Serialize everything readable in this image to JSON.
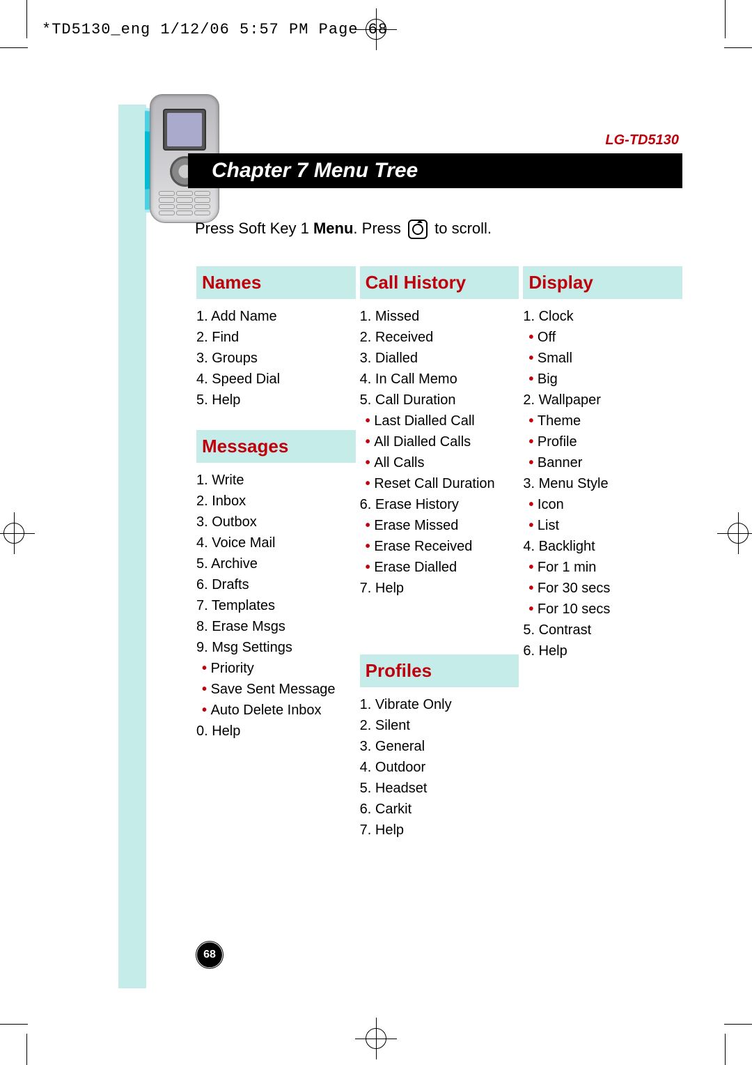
{
  "header": "*TD5130_eng  1/12/06  5:57 PM  Page 68",
  "model": "LG-TD5130",
  "chapter": "Chapter 7  Menu Tree",
  "instruction_pre": "Press Soft Key 1 ",
  "instruction_bold": "Menu",
  "instruction_mid": ". Press ",
  "instruction_post": " to scroll.",
  "page_number": "68",
  "columns": {
    "left": [
      {
        "heading": "Names",
        "items": [
          {
            "n": "1",
            "t": "Add Name"
          },
          {
            "n": "2",
            "t": "Find"
          },
          {
            "n": "3",
            "t": "Groups"
          },
          {
            "n": "4",
            "t": "Speed Dial"
          },
          {
            "n": "5",
            "t": "Help"
          }
        ]
      },
      {
        "heading": "Messages",
        "items": [
          {
            "n": "1",
            "t": "Write"
          },
          {
            "n": "2",
            "t": "Inbox"
          },
          {
            "n": "3",
            "t": "Outbox"
          },
          {
            "n": "4",
            "t": "Voice Mail"
          },
          {
            "n": "5",
            "t": "Archive"
          },
          {
            "n": "6",
            "t": "Drafts"
          },
          {
            "n": "7",
            "t": "Templates"
          },
          {
            "n": "8",
            "t": "Erase Msgs"
          },
          {
            "n": "9",
            "t": "Msg Settings",
            "sub": [
              "Priority",
              "Save Sent Message",
              "Auto Delete Inbox"
            ]
          },
          {
            "n": "0",
            "t": "Help"
          }
        ]
      }
    ],
    "mid": [
      {
        "heading": "Call History",
        "items": [
          {
            "n": "1",
            "t": "Missed"
          },
          {
            "n": "2",
            "t": "Received"
          },
          {
            "n": "3",
            "t": "Dialled"
          },
          {
            "n": "4",
            "t": "In Call Memo"
          },
          {
            "n": "5",
            "t": "Call Duration",
            "sub": [
              "Last Dialled Call",
              "All Dialled Calls",
              "All Calls",
              "Reset Call Duration"
            ]
          },
          {
            "n": "6",
            "t": "Erase History",
            "sub": [
              "Erase Missed",
              "Erase Received",
              "Erase Dialled"
            ]
          },
          {
            "n": "7",
            "t": "Help"
          }
        ]
      },
      {
        "heading": "Profiles",
        "items": [
          {
            "n": "1",
            "t": "Vibrate Only"
          },
          {
            "n": "2",
            "t": "Silent"
          },
          {
            "n": "3",
            "t": "General"
          },
          {
            "n": "4",
            "t": "Outdoor"
          },
          {
            "n": "5",
            "t": "Headset"
          },
          {
            "n": "6",
            "t": "Carkit"
          },
          {
            "n": "7",
            "t": "Help"
          }
        ]
      }
    ],
    "right": [
      {
        "heading": "Display",
        "items": [
          {
            "n": "1",
            "t": "Clock",
            "sub": [
              "Off",
              "Small",
              "Big"
            ]
          },
          {
            "n": "2",
            "t": "Wallpaper",
            "sub": [
              "Theme",
              "Profile",
              "Banner"
            ]
          },
          {
            "n": "3",
            "t": "Menu Style",
            "sub": [
              "Icon",
              "List"
            ]
          },
          {
            "n": "4",
            "t": "Backlight",
            "sub": [
              "For 1 min",
              "For 30 secs",
              "For 10 secs"
            ]
          },
          {
            "n": "5",
            "t": "Contrast"
          },
          {
            "n": "6",
            "t": "Help"
          }
        ]
      }
    ]
  }
}
